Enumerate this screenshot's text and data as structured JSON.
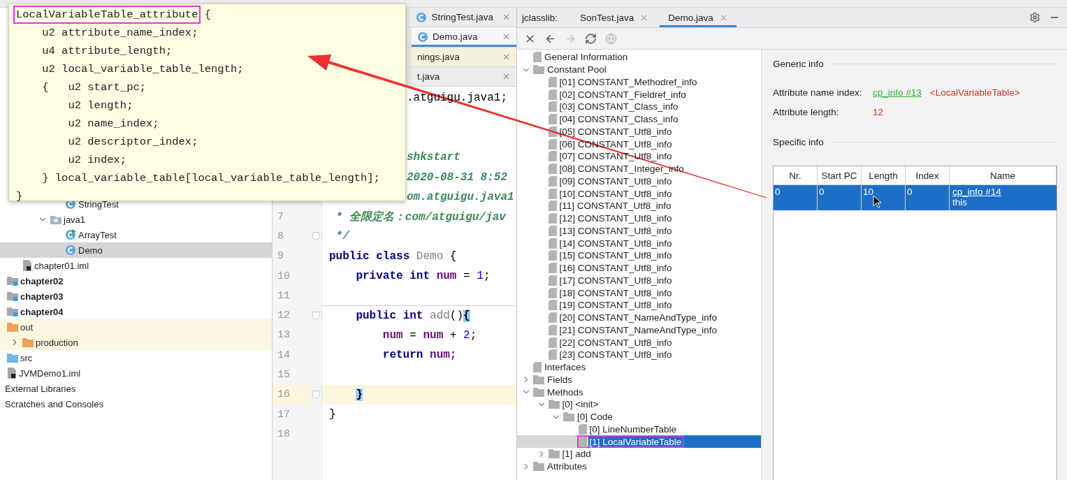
{
  "popup": {
    "title": "LocalVariableTable_attribute",
    "title_annotated": true,
    "open_brace": "{",
    "lines": [
      "    u2 attribute_name_index;",
      "    u4 attribute_length;",
      "    u2 local_variable_table_length;",
      "    {   u2 start_pc;",
      "        u2 length;",
      "        u2 name_index;",
      "        u2 descriptor_index;",
      "        u2 index;",
      "    } local_variable_table[local_variable_table_length];"
    ],
    "close_brace": "}"
  },
  "project_tree": [
    {
      "children": [
        {
          "children": [
            {
              "children": [
                {
                  "children": [
                    {
                      "label": "StringTest",
                      "kind": "class",
                      "selected": false
                    }
                  ]
                },
                {
                  "label": "java1",
                  "kind": "package",
                  "selected": false,
                  "expanded": true,
                  "children": [
                    {
                      "label": "ArrayTest",
                      "kind": "class-runnable",
                      "selected": false
                    },
                    {
                      "label": "Demo",
                      "kind": "class",
                      "selected": true
                    }
                  ]
                }
              ]
            },
            {
              "label": "chapter01.iml",
              "kind": "iml",
              "selected": false
            }
          ]
        },
        {
          "label": "chapter02",
          "kind": "module",
          "selected": false
        },
        {
          "label": "chapter03",
          "kind": "module",
          "selected": false
        },
        {
          "label": "chapter04",
          "kind": "module",
          "selected": false
        },
        {
          "label": "out",
          "kind": "excluded-folder",
          "selected": false,
          "children": [
            {
              "label": "production",
              "kind": "excluded-folder",
              "selected": false,
              "expanded": false
            }
          ]
        },
        {
          "label": "src",
          "kind": "source-folder",
          "selected": false
        },
        {
          "label": "JVMDemo1.iml",
          "kind": "iml",
          "selected": false
        }
      ]
    },
    {
      "label": "External Libraries",
      "selected": false
    },
    {
      "label": "Scratches and Consoles",
      "selected": false
    }
  ],
  "editor": {
    "tabs": [
      {
        "label": "StringTest.java",
        "kind": "class",
        "selected": false,
        "color": "#ececec"
      },
      {
        "label": "Demo.java",
        "kind": "class",
        "selected": true,
        "color": "#f7f7f7"
      },
      {
        "label": "nings.java",
        "kind": "plain",
        "selected": false,
        "color": "#f3f1dc"
      },
      {
        "label": "t.java",
        "kind": "plain",
        "selected": false,
        "color": "#ececec"
      }
    ],
    "lines": [
      {
        "partial": true,
        "tokens": [
          {
            "text": ".atguigu.java1;",
            "kind": "plain"
          }
        ]
      },
      {
        "partial": true,
        "blank_lines_before": true,
        "tokens": [
          {
            "text": "shkstart",
            "kind": "comment"
          }
        ]
      },
      {
        "partial": true,
        "tokens": [
          {
            "text": "2020-08-31 8:52",
            "kind": "comment"
          }
        ]
      },
      {
        "partial": true,
        "tokens": [
          {
            "text": "om.atguigu.java1",
            "kind": "comment"
          }
        ]
      },
      {
        "number": "7",
        "current": false,
        "tokens": [
          {
            "text": " * 全限定名：com/atguigu/jav",
            "kind": "comment"
          }
        ]
      },
      {
        "number": "8",
        "fold": true,
        "current": false,
        "tokens": [
          {
            "text": " */",
            "kind": "comment"
          }
        ]
      },
      {
        "number": "9",
        "current": false,
        "tokens": [
          {
            "text": "public",
            "kind": "keyword"
          },
          {
            "text": " class",
            "kind": "keyword"
          },
          {
            "text": " Demo",
            "kind": "unused"
          },
          {
            "text": " {",
            "kind": "plain"
          }
        ]
      },
      {
        "number": "10",
        "current": false,
        "tokens": [
          {
            "text": "    private",
            "kind": "keyword"
          },
          {
            "text": " int",
            "kind": "keyword"
          },
          {
            "text": " num",
            "kind": "field"
          },
          {
            "text": " = ",
            "kind": "plain"
          },
          {
            "text": "1",
            "kind": "number"
          },
          {
            "text": ";",
            "kind": "plain"
          }
        ]
      },
      {
        "number": "11",
        "current": false
      },
      {
        "number": "12",
        "fold": true,
        "current": false,
        "separator_above": true,
        "tokens": [
          {
            "text": "    public",
            "kind": "keyword"
          },
          {
            "text": " int",
            "kind": "keyword"
          },
          {
            "text": " add",
            "kind": "unused"
          },
          {
            "text": "()",
            "kind": "plain"
          },
          {
            "text": "{",
            "kind": "brace-match"
          }
        ]
      },
      {
        "number": "13",
        "current": false,
        "tokens": [
          {
            "text": "        num",
            "kind": "field"
          },
          {
            "text": " = ",
            "kind": "plain"
          },
          {
            "text": "num",
            "kind": "field"
          },
          {
            "text": " + ",
            "kind": "plain"
          },
          {
            "text": "2",
            "kind": "number"
          },
          {
            "text": ";",
            "kind": "plain"
          }
        ]
      },
      {
        "number": "14",
        "current": false,
        "tokens": [
          {
            "text": "        return",
            "kind": "keyword"
          },
          {
            "text": " num",
            "kind": "field"
          },
          {
            "text": ";",
            "kind": "plain"
          }
        ]
      },
      {
        "number": "15",
        "current": false
      },
      {
        "number": "16",
        "fold": true,
        "current": true,
        "tokens": [
          {
            "text": "    }",
            "kind": "brace-match"
          }
        ]
      },
      {
        "number": "17",
        "current": false,
        "tokens": [
          {
            "text": "}",
            "kind": "plain"
          }
        ]
      },
      {
        "number": "18",
        "current": false
      }
    ]
  },
  "jclasslib": {
    "label": "jclasslib:",
    "tabs": [
      {
        "label": "SonTest.java",
        "selected": false
      },
      {
        "label": "Demo.java",
        "selected": true
      }
    ],
    "toolbar": [
      {
        "kind": "close",
        "disabled": false
      },
      {
        "kind": "back",
        "disabled": false
      },
      {
        "kind": "forward",
        "disabled": true
      },
      {
        "kind": "refresh",
        "disabled": false
      },
      {
        "kind": "browser",
        "disabled": true
      }
    ],
    "tree": [
      {
        "label": "General Information",
        "kind": "file",
        "selected": false
      },
      {
        "label": "Constant Pool",
        "kind": "folder",
        "expanded": true,
        "selected": false,
        "children": [
          {
            "label": "[01] CONSTANT_Methodref_info",
            "kind": "file",
            "selected": false
          },
          {
            "label": "[02] CONSTANT_Fieldref_info",
            "kind": "file",
            "selected": false
          },
          {
            "label": "[03] CONSTANT_Class_info",
            "kind": "file",
            "selected": false
          },
          {
            "label": "[04] CONSTANT_Class_info",
            "kind": "file",
            "selected": false
          },
          {
            "label": "[05] CONSTANT_Utf8_info",
            "kind": "file",
            "selected": false
          },
          {
            "label": "[06] CONSTANT_Utf8_info",
            "kind": "file",
            "selected": false
          },
          {
            "label": "[07] CONSTANT_Utf8_info",
            "kind": "file",
            "selected": false
          },
          {
            "label": "[08] CONSTANT_Integer_info",
            "kind": "file",
            "selected": false
          },
          {
            "label": "[09] CONSTANT_Utf8_info",
            "kind": "file",
            "selected": false
          },
          {
            "label": "[10] CONSTANT_Utf8_info",
            "kind": "file",
            "selected": false
          },
          {
            "label": "[11] CONSTANT_Utf8_info",
            "kind": "file",
            "selected": false
          },
          {
            "label": "[12] CONSTANT_Utf8_info",
            "kind": "file",
            "selected": false
          },
          {
            "label": "[13] CONSTANT_Utf8_info",
            "kind": "file",
            "selected": false
          },
          {
            "label": "[14] CONSTANT_Utf8_info",
            "kind": "file",
            "selected": false
          },
          {
            "label": "[15] CONSTANT_Utf8_info",
            "kind": "file",
            "selected": false
          },
          {
            "label": "[16] CONSTANT_Utf8_info",
            "kind": "file",
            "selected": false
          },
          {
            "label": "[17] CONSTANT_Utf8_info",
            "kind": "file",
            "selected": false
          },
          {
            "label": "[18] CONSTANT_Utf8_info",
            "kind": "file",
            "selected": false
          },
          {
            "label": "[19] CONSTANT_Utf8_info",
            "kind": "file",
            "selected": false
          },
          {
            "label": "[20] CONSTANT_NameAndType_info",
            "kind": "file",
            "selected": false
          },
          {
            "label": "[21] CONSTANT_NameAndType_info",
            "kind": "file",
            "selected": false
          },
          {
            "label": "[22] CONSTANT_Utf8_info",
            "kind": "file",
            "selected": false
          },
          {
            "label": "[23] CONSTANT_Utf8_info",
            "kind": "file",
            "selected": false
          }
        ]
      },
      {
        "label": "Interfaces",
        "kind": "file",
        "selected": false
      },
      {
        "label": "Fields",
        "kind": "folder",
        "expanded": false,
        "selected": false
      },
      {
        "label": "Methods",
        "kind": "folder",
        "expanded": true,
        "selected": false,
        "children": [
          {
            "label": "[0] <init>",
            "kind": "folder",
            "expanded": true,
            "selected": false,
            "children": [
              {
                "label": "[0] Code",
                "kind": "folder",
                "expanded": true,
                "selected": false,
                "children": [
                  {
                    "label": "[0] LineNumberTable",
                    "kind": "file",
                    "selected": false
                  },
                  {
                    "label": "[1] LocalVariableTable",
                    "kind": "file",
                    "selected": true,
                    "annotated": true
                  }
                ]
              }
            ]
          },
          {
            "label": "[1] add",
            "kind": "folder",
            "expanded": false,
            "selected": false
          }
        ]
      },
      {
        "label": "Attributes",
        "kind": "folder",
        "expanded": false,
        "selected": false
      }
    ]
  },
  "detail": {
    "generic_title": "Generic info",
    "fields": [
      {
        "label": "Attribute name index:",
        "link": "cp_info #13",
        "value": "<LocalVariableTable>"
      },
      {
        "label": "Attribute length:",
        "value": "12"
      }
    ],
    "specific_title": "Specific info",
    "table": {
      "columns": [
        "Nr.",
        "Start PC",
        "Length",
        "Index",
        "Name"
      ],
      "rows": [
        {
          "selected": true,
          "cells": [
            "0",
            "0",
            "10",
            "0"
          ],
          "name_link": "cp_info #14",
          "name_text": "this"
        }
      ]
    }
  }
}
